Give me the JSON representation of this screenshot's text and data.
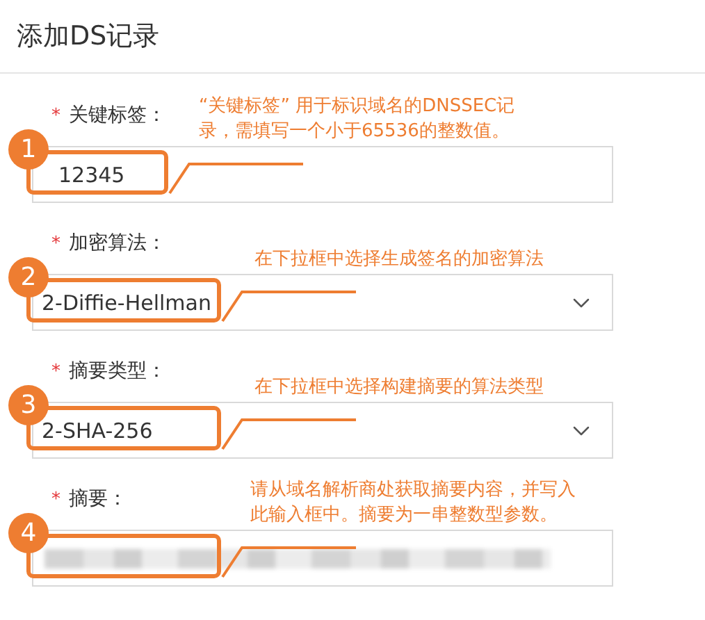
{
  "title": "添加DS记录",
  "fields": [
    {
      "kind": "text",
      "required_mark": "*",
      "label": "关键标签：",
      "value": "12345",
      "step": "1",
      "note": "“关键标签” 用于标识域名的DNSSEC记录，需填写一个小于65536的整数值。"
    },
    {
      "kind": "select",
      "required_mark": "*",
      "label": "加密算法：",
      "value": "2-Diffie-Hellman",
      "step": "2",
      "note": "在下拉框中选择生成签名的加密算法"
    },
    {
      "kind": "select",
      "required_mark": "*",
      "label": "摘要类型：",
      "value": "2-SHA-256",
      "step": "3",
      "note": "在下拉框中选择构建摘要的算法类型"
    },
    {
      "kind": "redacted",
      "required_mark": "*",
      "label": "摘要：",
      "step": "4",
      "note": "请从域名解析商处获取摘要内容，并写入此输入框中。摘要为一串整数型参数。"
    }
  ]
}
